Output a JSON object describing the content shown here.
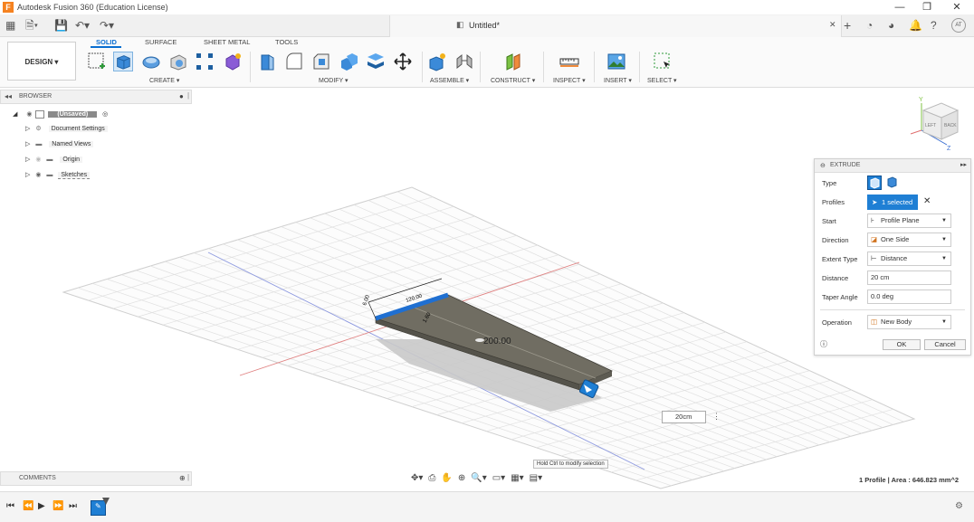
{
  "window": {
    "title": "Autodesk Fusion 360 (Education License)",
    "logo_letter": "F",
    "minimize": "—",
    "maximize": "❐",
    "close": "✕"
  },
  "document": {
    "tab_title": "Untitled*",
    "tab_close": "✕",
    "new_tab": "+",
    "user_initials": "AT"
  },
  "ribbon": {
    "workspace": "DESIGN ▾",
    "tabs": [
      "SOLID",
      "SURFACE",
      "SHEET METAL",
      "TOOLS"
    ],
    "active_tab": "SOLID",
    "groups": [
      "CREATE ▾",
      "MODIFY ▾",
      "ASSEMBLE ▾",
      "CONSTRUCT ▾",
      "INSPECT ▾",
      "INSERT ▾",
      "SELECT ▾"
    ]
  },
  "browser": {
    "label": "BROWSER",
    "root": "(Unsaved)",
    "items": [
      "Document Settings",
      "Named Views",
      "Origin",
      "Sketches"
    ]
  },
  "viewcube": {
    "top_axis": "Y",
    "side_axis": "Z",
    "face_left": "LEFT",
    "face_back": "BACK"
  },
  "viewport": {
    "dim_label_1": "120.00",
    "dim_label_2": "6.00",
    "dim_label_3": "1.60",
    "center_label": "200.00",
    "distance_box": "20cm",
    "tooltip": "Hold Ctrl to modify selection",
    "status": "1 Profile | Area : 646.823 mm^2"
  },
  "extrude": {
    "title": "EXTRUDE",
    "labels": {
      "type": "Type",
      "profiles": "Profiles",
      "start": "Start",
      "direction": "Direction",
      "extent_type": "Extent Type",
      "distance": "Distance",
      "taper_angle": "Taper Angle",
      "operation": "Operation"
    },
    "profiles_selected": "1 selected",
    "start": "Profile Plane",
    "direction": "One Side",
    "extent_type": "Distance",
    "distance": "20 cm",
    "taper_angle": "0.0 deg",
    "operation": "New Body",
    "ok": "OK",
    "cancel": "Cancel"
  },
  "comments": {
    "label": "COMMENTS"
  },
  "colors": {
    "accent": "#0a6ed1",
    "body": "#6f6c62",
    "selected_edge": "#1f6fd1",
    "grid": "#d8d8d8",
    "x_axis": "#e57373",
    "z_axis": "#7f8fd6"
  }
}
